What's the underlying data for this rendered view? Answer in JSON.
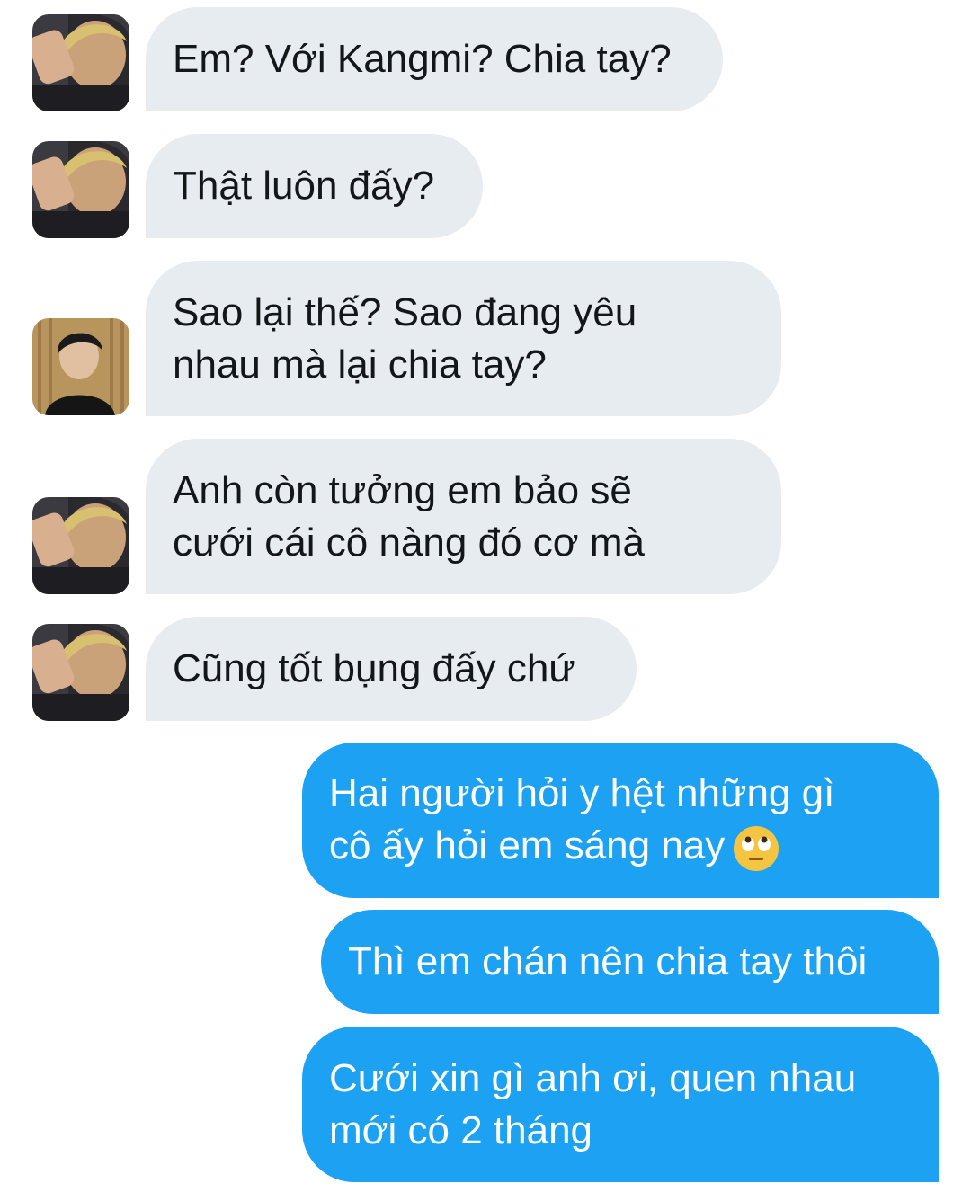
{
  "colors": {
    "received_bubble": "#e6ecf0",
    "sent_bubble": "#1da1f2",
    "received_text": "#14171a",
    "sent_text": "#ffffff"
  },
  "messages": [
    {
      "direction": "received",
      "avatar": "user-avatar-peace-sign",
      "text": "Em? Với Kangmi? Chia tay?"
    },
    {
      "direction": "received",
      "avatar": "user-avatar-peace-sign",
      "text": "Thật luôn đấy?"
    },
    {
      "direction": "received",
      "avatar": "user-avatar-curtain",
      "text": "Sao lại thế? Sao đang yêu\nnhau mà lại chia tay?"
    },
    {
      "direction": "received",
      "avatar": "user-avatar-peace-sign",
      "text": "Anh còn tưởng em bảo sẽ\ncưới cái cô nàng đó cơ mà"
    },
    {
      "direction": "received",
      "avatar": "user-avatar-peace-sign",
      "text": "Cũng tốt bụng đấy chứ"
    },
    {
      "direction": "sent",
      "text": "Hai người hỏi y hệt những gì\ncô ấy hỏi em sáng nay",
      "emoji": "face-with-rolling-eyes-emoji"
    },
    {
      "direction": "sent",
      "text": "Thì em chán nên chia tay thôi"
    },
    {
      "direction": "sent",
      "text": "Cưới xin gì anh ơi, quen nhau\nmới có 2 tháng"
    }
  ]
}
